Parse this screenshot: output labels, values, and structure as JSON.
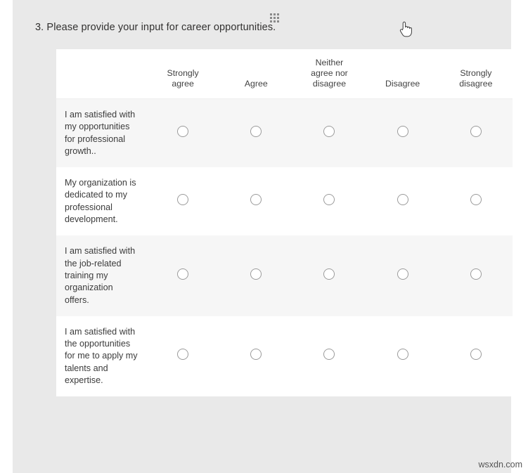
{
  "page": {
    "background_color": "#ffffff",
    "panel_color": "#e9e9e9",
    "watermark": "wsxdn.com"
  },
  "question": {
    "number": "3.",
    "text": "3. Please provide your input for career opportunities.",
    "drag_handle_icon": "drag-dots-icon"
  },
  "cursor": {
    "icon": "pointing-hand-cursor"
  },
  "matrix": {
    "columns": [
      {
        "label": "Strongly\nagree",
        "line1": "Strongly",
        "line2": "agree",
        "line3": ""
      },
      {
        "label": "Agree",
        "line1": "",
        "line2": "Agree",
        "line3": ""
      },
      {
        "label": "Neither agree nor disagree",
        "line1": "Neither",
        "line2": "agree nor",
        "line3": "disagree"
      },
      {
        "label": "Disagree",
        "line1": "",
        "line2": "Disagree",
        "line3": ""
      },
      {
        "label": "Strongly\ndisagree",
        "line1": "Strongly",
        "line2": "disagree",
        "line3": ""
      }
    ],
    "rows": [
      {
        "label": "I am satisfied with my opportunities for professional growth..",
        "shaded": true,
        "selected": null
      },
      {
        "label": "My organization is dedicated to my professional development.",
        "shaded": false,
        "selected": null
      },
      {
        "label": "I am satisfied with the job-related training my organization offers.",
        "shaded": true,
        "selected": null
      },
      {
        "label": "I am satisfied with the opportunities for me to apply my talents and expertise.",
        "shaded": false,
        "selected": null
      }
    ],
    "radio_icon": "radio-button-unselected-icon"
  }
}
